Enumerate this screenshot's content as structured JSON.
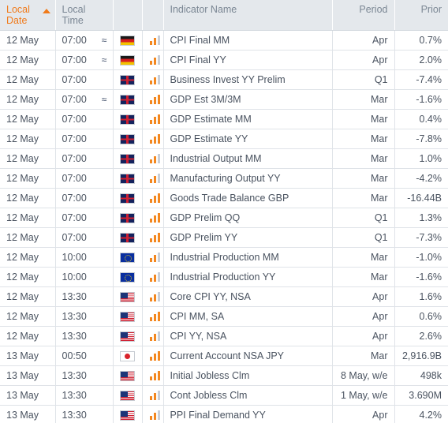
{
  "table": {
    "columns": [
      {
        "key": "local_date",
        "label": "Local Date",
        "sorted": true,
        "sort_direction": "asc"
      },
      {
        "key": "local_time",
        "label": "Local Time",
        "sorted": false
      },
      {
        "key": "flag",
        "label": "",
        "sorted": false
      },
      {
        "key": "impact",
        "label": "",
        "sorted": false
      },
      {
        "key": "indicator_name",
        "label": "Indicator Name",
        "sorted": false
      },
      {
        "key": "period",
        "label": "Period",
        "sorted": false
      },
      {
        "key": "prior",
        "label": "Prior",
        "sorted": false
      }
    ],
    "sort_arrow_icon": "sort-ascending-arrow-icon",
    "approx_icon_glyph": "≈",
    "accent_color": "#f07a1a",
    "header_text_color": "#7b8794",
    "header_background": "#e4e8ec",
    "rows": [
      {
        "local_date": "12 May",
        "local_time": "07:00",
        "approx": true,
        "flag": "de",
        "flag_name": "germany-flag-icon",
        "impact_filled": 2,
        "impact_total": 3,
        "indicator_name": "CPI Final MM",
        "period": "Apr",
        "prior": "0.7%"
      },
      {
        "local_date": "12 May",
        "local_time": "07:00",
        "approx": true,
        "flag": "de",
        "flag_name": "germany-flag-icon",
        "impact_filled": 2,
        "impact_total": 3,
        "indicator_name": "CPI Final YY",
        "period": "Apr",
        "prior": "2.0%"
      },
      {
        "local_date": "12 May",
        "local_time": "07:00",
        "approx": false,
        "flag": "gb",
        "flag_name": "united-kingdom-flag-icon",
        "impact_filled": 2,
        "impact_total": 3,
        "indicator_name": "Business Invest YY Prelim",
        "period": "Q1",
        "prior": "-7.4%"
      },
      {
        "local_date": "12 May",
        "local_time": "07:00",
        "approx": true,
        "flag": "gb",
        "flag_name": "united-kingdom-flag-icon",
        "impact_filled": 3,
        "impact_total": 3,
        "indicator_name": "GDP Est 3M/3M",
        "period": "Mar",
        "prior": "-1.6%"
      },
      {
        "local_date": "12 May",
        "local_time": "07:00",
        "approx": false,
        "flag": "gb",
        "flag_name": "united-kingdom-flag-icon",
        "impact_filled": 3,
        "impact_total": 3,
        "indicator_name": "GDP Estimate MM",
        "period": "Mar",
        "prior": "0.4%"
      },
      {
        "local_date": "12 May",
        "local_time": "07:00",
        "approx": false,
        "flag": "gb",
        "flag_name": "united-kingdom-flag-icon",
        "impact_filled": 3,
        "impact_total": 3,
        "indicator_name": "GDP Estimate YY",
        "period": "Mar",
        "prior": "-7.8%"
      },
      {
        "local_date": "12 May",
        "local_time": "07:00",
        "approx": false,
        "flag": "gb",
        "flag_name": "united-kingdom-flag-icon",
        "impact_filled": 2,
        "impact_total": 3,
        "indicator_name": "Industrial Output MM",
        "period": "Mar",
        "prior": "1.0%"
      },
      {
        "local_date": "12 May",
        "local_time": "07:00",
        "approx": false,
        "flag": "gb",
        "flag_name": "united-kingdom-flag-icon",
        "impact_filled": 2,
        "impact_total": 3,
        "indicator_name": "Manufacturing Output YY",
        "period": "Mar",
        "prior": "-4.2%"
      },
      {
        "local_date": "12 May",
        "local_time": "07:00",
        "approx": false,
        "flag": "gb",
        "flag_name": "united-kingdom-flag-icon",
        "impact_filled": 3,
        "impact_total": 3,
        "indicator_name": "Goods Trade Balance GBP",
        "period": "Mar",
        "prior": "-16.44B"
      },
      {
        "local_date": "12 May",
        "local_time": "07:00",
        "approx": false,
        "flag": "gb",
        "flag_name": "united-kingdom-flag-icon",
        "impact_filled": 3,
        "impact_total": 3,
        "indicator_name": "GDP Prelim QQ",
        "period": "Q1",
        "prior": "1.3%"
      },
      {
        "local_date": "12 May",
        "local_time": "07:00",
        "approx": false,
        "flag": "gb",
        "flag_name": "united-kingdom-flag-icon",
        "impact_filled": 3,
        "impact_total": 3,
        "indicator_name": "GDP Prelim YY",
        "period": "Q1",
        "prior": "-7.3%"
      },
      {
        "local_date": "12 May",
        "local_time": "10:00",
        "approx": false,
        "flag": "eu",
        "flag_name": "european-union-flag-icon",
        "impact_filled": 2,
        "impact_total": 3,
        "indicator_name": "Industrial Production MM",
        "period": "Mar",
        "prior": "-1.0%"
      },
      {
        "local_date": "12 May",
        "local_time": "10:00",
        "approx": false,
        "flag": "eu",
        "flag_name": "european-union-flag-icon",
        "impact_filled": 2,
        "impact_total": 3,
        "indicator_name": "Industrial Production YY",
        "period": "Mar",
        "prior": "-1.6%"
      },
      {
        "local_date": "12 May",
        "local_time": "13:30",
        "approx": false,
        "flag": "us",
        "flag_name": "united-states-flag-icon",
        "impact_filled": 2,
        "impact_total": 3,
        "indicator_name": "Core CPI YY, NSA",
        "period": "Apr",
        "prior": "1.6%"
      },
      {
        "local_date": "12 May",
        "local_time": "13:30",
        "approx": false,
        "flag": "us",
        "flag_name": "united-states-flag-icon",
        "impact_filled": 3,
        "impact_total": 3,
        "indicator_name": "CPI MM, SA",
        "period": "Apr",
        "prior": "0.6%"
      },
      {
        "local_date": "12 May",
        "local_time": "13:30",
        "approx": false,
        "flag": "us",
        "flag_name": "united-states-flag-icon",
        "impact_filled": 2,
        "impact_total": 3,
        "indicator_name": "CPI YY, NSA",
        "period": "Apr",
        "prior": "2.6%"
      },
      {
        "local_date": "13 May",
        "local_time": "00:50",
        "approx": false,
        "flag": "jp",
        "flag_name": "japan-flag-icon",
        "impact_filled": 3,
        "impact_total": 3,
        "indicator_name": "Current Account NSA JPY",
        "period": "Mar",
        "prior": "2,916.9B"
      },
      {
        "local_date": "13 May",
        "local_time": "13:30",
        "approx": false,
        "flag": "us",
        "flag_name": "united-states-flag-icon",
        "impact_filled": 3,
        "impact_total": 3,
        "indicator_name": "Initial Jobless Clm",
        "period": "8 May, w/e",
        "prior": "498k"
      },
      {
        "local_date": "13 May",
        "local_time": "13:30",
        "approx": false,
        "flag": "us",
        "flag_name": "united-states-flag-icon",
        "impact_filled": 2,
        "impact_total": 3,
        "indicator_name": "Cont Jobless Clm",
        "period": "1 May, w/e",
        "prior": "3.690M"
      },
      {
        "local_date": "13 May",
        "local_time": "13:30",
        "approx": false,
        "flag": "us",
        "flag_name": "united-states-flag-icon",
        "impact_filled": 2,
        "impact_total": 3,
        "indicator_name": "PPI Final Demand YY",
        "period": "Apr",
        "prior": "4.2%"
      }
    ]
  }
}
